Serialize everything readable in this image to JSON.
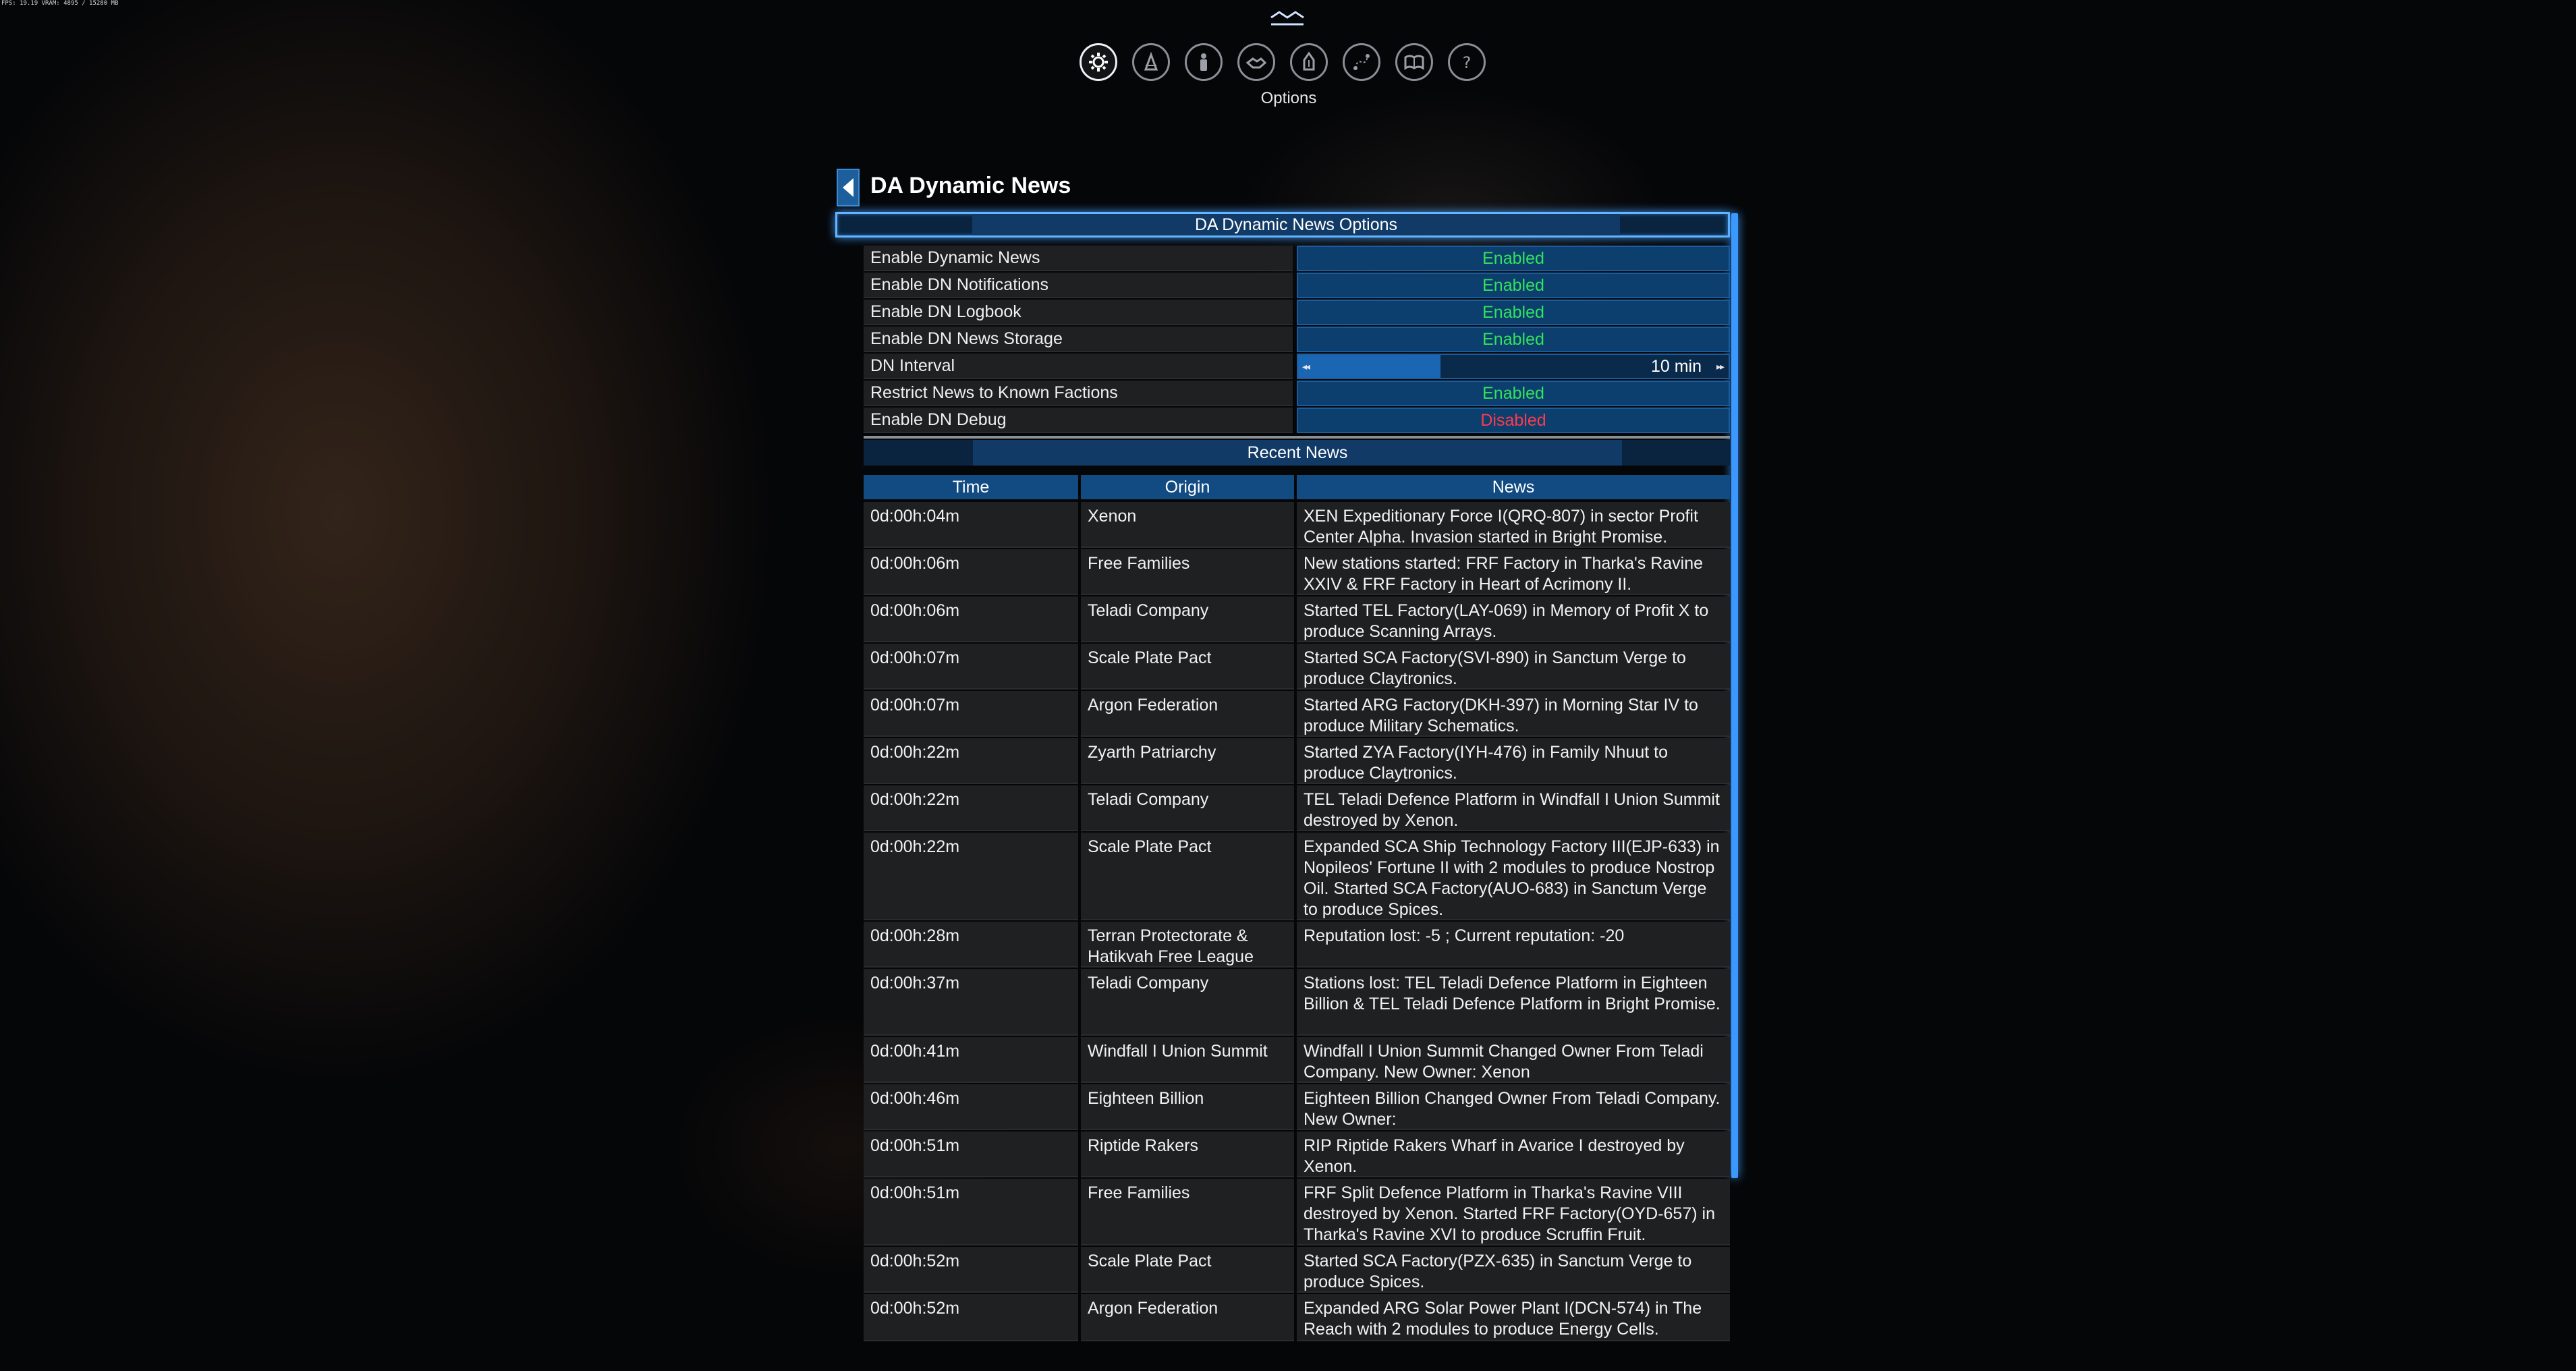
{
  "fps_text": "FPS: 19.19 VRAM: 4895 / 15280 MB",
  "top_icons": [
    {
      "name": "options-icon",
      "active": true
    },
    {
      "name": "player-info-icon",
      "active": false
    },
    {
      "name": "character-icon",
      "active": false
    },
    {
      "name": "diplomacy-icon",
      "active": false
    },
    {
      "name": "property-icon",
      "active": false
    },
    {
      "name": "map-icon",
      "active": false
    },
    {
      "name": "encyclopedia-icon",
      "active": false
    },
    {
      "name": "help-icon",
      "active": false
    }
  ],
  "active_icon_label": "Options",
  "menu": {
    "title": "DA Dynamic News",
    "options_header": "DA Dynamic News Options",
    "options": [
      {
        "label": "Enable Dynamic News",
        "value": "Enabled",
        "state": "on"
      },
      {
        "label": "Enable DN Notifications",
        "value": "Enabled",
        "state": "on"
      },
      {
        "label": "Enable DN Logbook",
        "value": "Enabled",
        "state": "on"
      },
      {
        "label": "Enable DN News Storage",
        "value": "Enabled",
        "state": "on"
      },
      {
        "label": "DN Interval",
        "value": "10 min",
        "type": "slider"
      },
      {
        "label": "Restrict News to Known Factions",
        "value": "Enabled",
        "state": "on"
      },
      {
        "label": "Enable DN Debug",
        "value": "Disabled",
        "state": "off"
      }
    ],
    "recent_header": "Recent News",
    "columns": {
      "time": "Time",
      "origin": "Origin",
      "news": "News"
    },
    "news": [
      {
        "time": "0d:00h:04m",
        "origin": "Xenon",
        "news": "XEN Expeditionary Force I(QRQ-807) in sector Profit Center Alpha. Invasion started in Bright Promise."
      },
      {
        "time": "0d:00h:06m",
        "origin": "Free Families",
        "news": "New stations started: FRF Factory in Tharka's Ravine XXIV & FRF Factory in Heart of Acrimony II."
      },
      {
        "time": "0d:00h:06m",
        "origin": "Teladi Company",
        "news": "Started TEL Factory(LAY-069) in Memory of Profit X to produce Scanning Arrays."
      },
      {
        "time": "0d:00h:07m",
        "origin": "Scale Plate Pact",
        "news": "Started SCA Factory(SVI-890) in Sanctum Verge to produce Claytronics."
      },
      {
        "time": "0d:00h:07m",
        "origin": "Argon Federation",
        "news": "Started ARG Factory(DKH-397) in Morning Star IV to produce Military Schematics."
      },
      {
        "time": "0d:00h:22m",
        "origin": "Zyarth Patriarchy",
        "news": "Started ZYA Factory(IYH-476) in Family Nhuut to produce Claytronics."
      },
      {
        "time": "0d:00h:22m",
        "origin": "Teladi Company",
        "news": "TEL Teladi Defence Platform in Windfall I Union Summit destroyed by Xenon."
      },
      {
        "time": "0d:00h:22m",
        "origin": "Scale Plate Pact",
        "news": "Expanded SCA Ship Technology Factory III(EJP-633) in Nopileos' Fortune II with 2 modules to produce Nostrop Oil. Started SCA Factory(AUO-683) in Sanctum Verge to produce Spices."
      },
      {
        "time": "0d:00h:28m",
        "origin": "Terran Protectorate & Hatikvah Free League",
        "news": "Reputation lost: -5 ; Current reputation: -20"
      },
      {
        "time": "0d:00h:37m",
        "origin": "Teladi Company",
        "news": "Stations lost: TEL Teladi Defence Platform in Eighteen Billion & TEL Teladi Defence Platform in Bright Promise."
      },
      {
        "time": "0d:00h:41m",
        "origin": "Windfall I Union Summit",
        "news": "Windfall I Union Summit Changed Owner From Teladi Company. New Owner: Xenon"
      },
      {
        "time": "0d:00h:46m",
        "origin": "Eighteen Billion",
        "news": "Eighteen Billion Changed Owner From Teladi Company. New Owner:"
      },
      {
        "time": "0d:00h:51m",
        "origin": "Riptide Rakers",
        "news": "RIP Riptide Rakers Wharf in Avarice I destroyed by Xenon."
      },
      {
        "time": "0d:00h:51m",
        "origin": "Free Families",
        "news": "FRF Split Defence Platform in Tharka's Ravine VIII destroyed by Xenon. Started FRF Factory(OYD-657) in Tharka's Ravine XVI to produce Scruffin Fruit."
      },
      {
        "time": "0d:00h:52m",
        "origin": "Scale Plate Pact",
        "news": "Started SCA Factory(PZX-635) in Sanctum Verge to produce Spices."
      },
      {
        "time": "0d:00h:52m",
        "origin": "Argon Federation",
        "news": "Expanded ARG Solar Power Plant I(DCN-574) in The Reach with 2 modules to produce Energy Cells."
      }
    ]
  },
  "colors": {
    "enabled": "#31e35c",
    "disabled": "#ff3b4c",
    "accent": "#3a98ff"
  }
}
